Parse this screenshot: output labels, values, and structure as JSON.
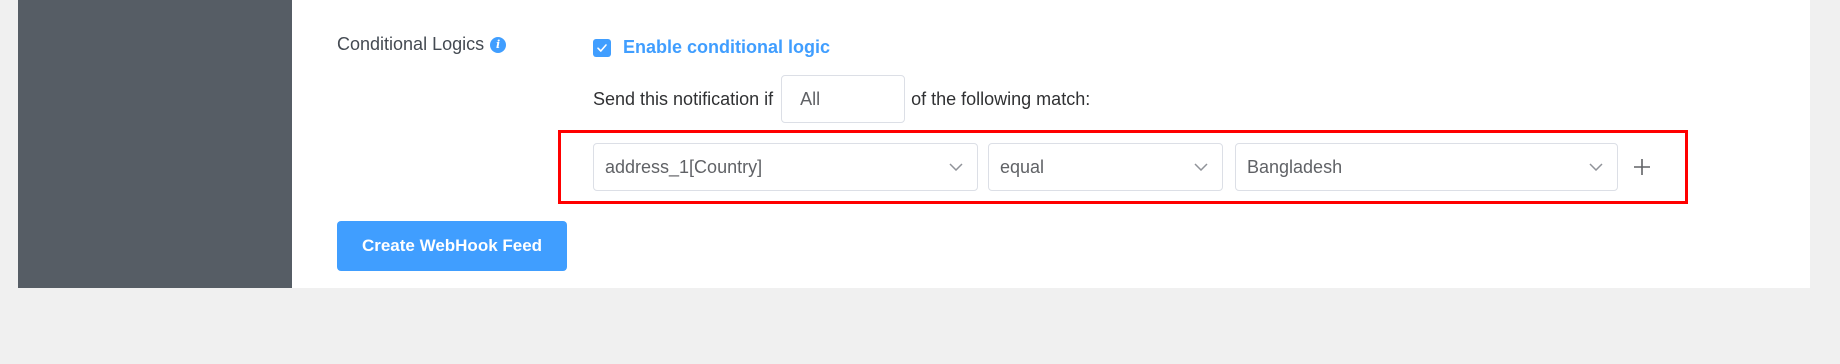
{
  "conditional": {
    "label": "Conditional Logics",
    "info_icon": "info-icon",
    "enable": {
      "checked": true,
      "label": "Enable conditional logic"
    },
    "send_prefix": "Send this notification if",
    "match_value": "All",
    "send_suffix": "of the following match:",
    "rule": {
      "field": "address_1[Country]",
      "operator": "equal",
      "value": "Bangladesh",
      "add_icon": "plus-icon"
    }
  },
  "actions": {
    "create_label": "Create WebHook Feed"
  },
  "colors": {
    "accent": "#409eff",
    "sidebar": "#565d65",
    "highlight": "#ff0000",
    "page_bg": "#f0f0f0"
  }
}
